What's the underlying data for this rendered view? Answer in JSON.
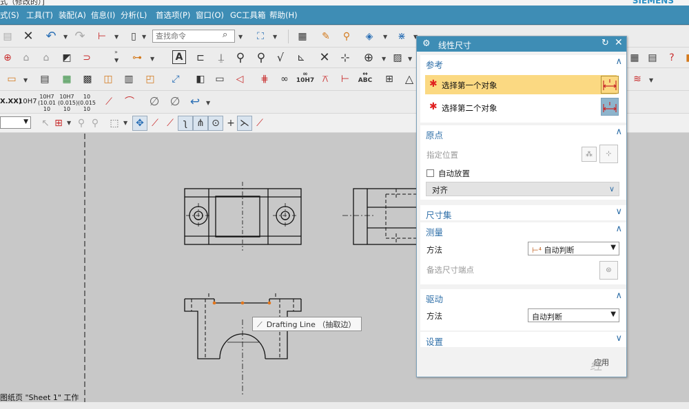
{
  "window": {
    "title": "式（修改的）]",
    "brand": "SIEMENS"
  },
  "menu": [
    {
      "label": "式(S)"
    },
    {
      "label": "工具(T)"
    },
    {
      "label": "装配(A)"
    },
    {
      "label": "信息(I)"
    },
    {
      "label": "分析(L)"
    },
    {
      "label": "首选项(P)"
    },
    {
      "label": "窗口(O)"
    },
    {
      "label": "GC工具箱"
    },
    {
      "label": "帮助(H)"
    }
  ],
  "toolbar": {
    "search_placeholder": "查找命令",
    "tol_tx": "X.XX)",
    "tol_10h7": "10H7",
    "tol_a1": "10H7",
    "tol_a2": "(10.01",
    "tol_a3": "10",
    "tol_b1": "10H7",
    "tol_b2": "(0.015)",
    "tol_b3": "10",
    "tol_c1": "10",
    "tol_c2": "(0.015",
    "tol_c3": "10",
    "icon_10h7": "10H7",
    "icon_abc": "ABC"
  },
  "tooltip": {
    "text": "Drafting Line （抽取边）"
  },
  "status": {
    "sheet": "图纸页 \"Sheet 1\" 工作"
  },
  "dialog": {
    "title": "线性尺寸",
    "sections": {
      "reference": "参考",
      "origin": "原点",
      "dim_set": "尺寸集",
      "measure": "测量",
      "driving": "驱动",
      "settings": "设置"
    },
    "select_first": "选择第一个对象",
    "select_second": "选择第二个对象",
    "specify_location": "指定位置",
    "auto_place": "自动放置",
    "align": "对齐",
    "method_label": "方法",
    "measure_method": "自动判断",
    "alt_point": "备选尺寸端点",
    "drive_method_label": "方法",
    "drive_method": "自动判断",
    "apply": "应用",
    "watermark": "经"
  },
  "colors": {
    "accent": "#3e8db5",
    "selected": "#fbd982",
    "required": "#e02020"
  }
}
